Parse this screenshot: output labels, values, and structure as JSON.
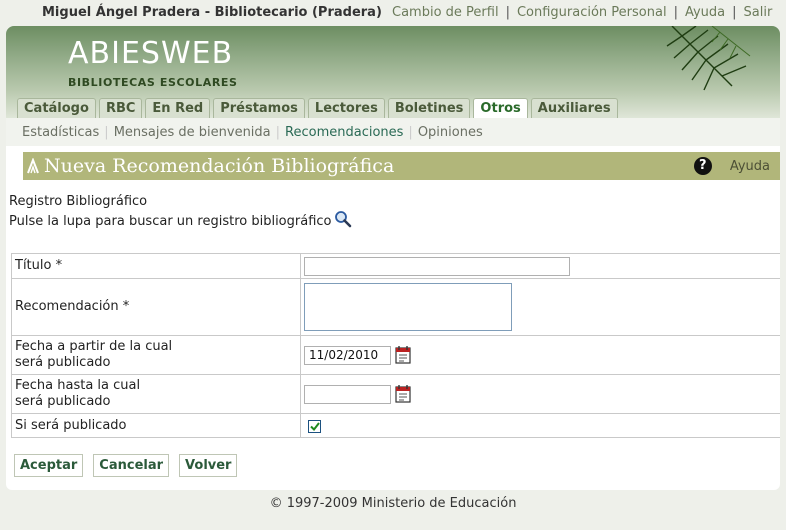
{
  "topbar": {
    "user": "Miguel Ángel Pradera - Bibliotecario (Pradera)",
    "links": [
      "Cambio de Perfil",
      "Configuración Personal",
      "Ayuda",
      "Salir"
    ]
  },
  "logo": {
    "main": "ABIESWEB",
    "sub": "BIBLIOTECAS ESCOLARES"
  },
  "tabs": [
    "Catálogo",
    "RBC",
    "En Red",
    "Préstamos",
    "Lectores",
    "Boletines",
    "Otros",
    "Auxiliares"
  ],
  "active_tab": "Otros",
  "subnav": [
    "Estadísticas",
    "Mensajes de bienvenida",
    "Recomendaciones",
    "Opiniones"
  ],
  "active_subnav": "Recomendaciones",
  "page_title": "Nueva Recomendación Bibliográfica",
  "help_label": "Ayuda",
  "registro": {
    "title": "Registro Bibliográfico",
    "hint": "Pulse la lupa para buscar un registro bibliográfico"
  },
  "form": {
    "titulo_label": "Título *",
    "titulo_value": "",
    "recomendacion_label": "Recomendación *",
    "recomendacion_value": "",
    "fecha_desde_label_1": "Fecha a partir de la cual",
    "fecha_desde_label_2": "será publicado",
    "fecha_desde_value": "11/02/2010",
    "fecha_hasta_label_1": "Fecha hasta la cual",
    "fecha_hasta_label_2": "será publicado",
    "fecha_hasta_value": "",
    "publicado_label": "Si será publicado",
    "publicado_checked": true
  },
  "buttons": {
    "accept": "Aceptar",
    "cancel": "Cancelar",
    "back": "Volver"
  },
  "footer": "© 1997-2009 Ministerio de Educación"
}
